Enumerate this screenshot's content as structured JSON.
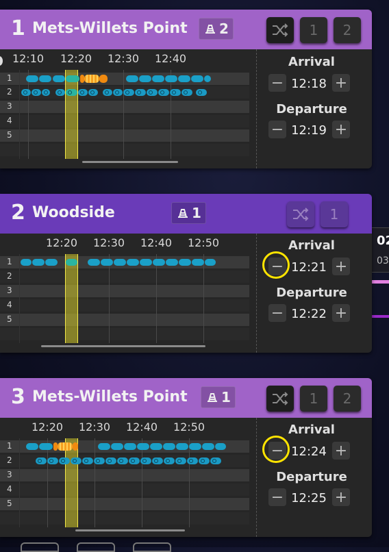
{
  "colors": {
    "header_purple": "#a063c8",
    "header_purple_active": "#6a3bb8",
    "train_blue": "#1aa0c8",
    "train_orange": "#f08a10",
    "highlight": "#f5ea4a"
  },
  "panels": [
    {
      "number": "1",
      "name": "Mets-Willets Point",
      "platform_count": "2",
      "platform_icon": "platform-icon",
      "shuffle_icon": "shuffle-icon",
      "track_buttons": [
        "1",
        "2"
      ],
      "ticks": [
        "12:10",
        "12:20",
        "12:30",
        "12:40"
      ],
      "rows": [
        "1",
        "2",
        "3",
        "4",
        "5"
      ],
      "arrival_label": "Arrival",
      "arrival": "12:18",
      "departure_label": "Departure",
      "departure": "12:19"
    },
    {
      "number": "2",
      "name": "Woodside",
      "platform_count": "1",
      "platform_icon": "platform-icon",
      "shuffle_icon": "shuffle-icon",
      "track_buttons": [
        "1"
      ],
      "ticks": [
        "12:20",
        "12:30",
        "12:40",
        "12:50"
      ],
      "rows": [
        "1",
        "2",
        "3",
        "4",
        "5"
      ],
      "arrival_label": "Arrival",
      "arrival": "12:21",
      "departure_label": "Departure",
      "departure": "12:22"
    },
    {
      "number": "3",
      "name": "Mets-Willets Point",
      "platform_count": "1",
      "platform_icon": "platform-icon",
      "shuffle_icon": "shuffle-icon",
      "track_buttons": [
        "1",
        "2"
      ],
      "ticks": [
        "12:20",
        "12:30",
        "12:40",
        "12:50"
      ],
      "rows": [
        "1",
        "2",
        "3",
        "4",
        "5"
      ],
      "arrival_label": "Arrival",
      "arrival": "12:24",
      "departure_label": "Departure",
      "departure": "12:25"
    }
  ],
  "behind": {
    "clip_a": "02",
    "clip_b": "03:"
  }
}
